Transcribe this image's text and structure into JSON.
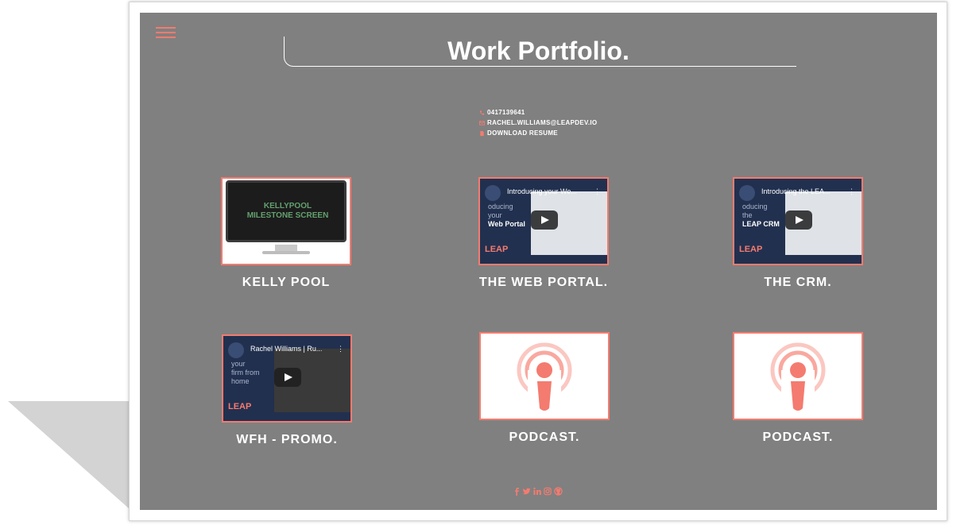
{
  "header": {
    "title": "Work Portfolio."
  },
  "contact": {
    "phone": "0417139641",
    "email": "RACHEL.WILLIAMS@LEAPDEV.IO",
    "resume": "DOWNLOAD RESUME"
  },
  "projects": [
    {
      "label": "KELLY POOL",
      "screen_text_1": "KELLYPOOL",
      "screen_text_2": "MILESTONE SCREEN"
    },
    {
      "label": "THE WEB PORTAL.",
      "video_title": "Introducing your We...",
      "small_1": "oducing",
      "small_2": "your",
      "small_3": "Web Portal",
      "brand": "LEAP"
    },
    {
      "label": "THE CRM.",
      "video_title": "Introducing the LEA...",
      "small_1": "oducing",
      "small_2": "the",
      "small_3": "LEAP CRM",
      "brand": "LEAP"
    },
    {
      "label": "WFH - PROMO.",
      "video_title": "Rachel Williams | Ru...",
      "small_1": "your",
      "small_2": "firm from",
      "small_3": "home",
      "brand": "LEAP"
    },
    {
      "label": "PODCAST."
    },
    {
      "label": "PODCAST."
    }
  ],
  "colors": {
    "accent": "#f47b6f",
    "page_bg": "#808080",
    "text": "#ffffff"
  },
  "icons": [
    "menu-icon",
    "phone-icon",
    "email-icon",
    "file-icon",
    "facebook-icon",
    "twitter-icon",
    "linkedin-icon",
    "instagram-icon",
    "github-icon",
    "podcast-icon",
    "play-icon"
  ]
}
